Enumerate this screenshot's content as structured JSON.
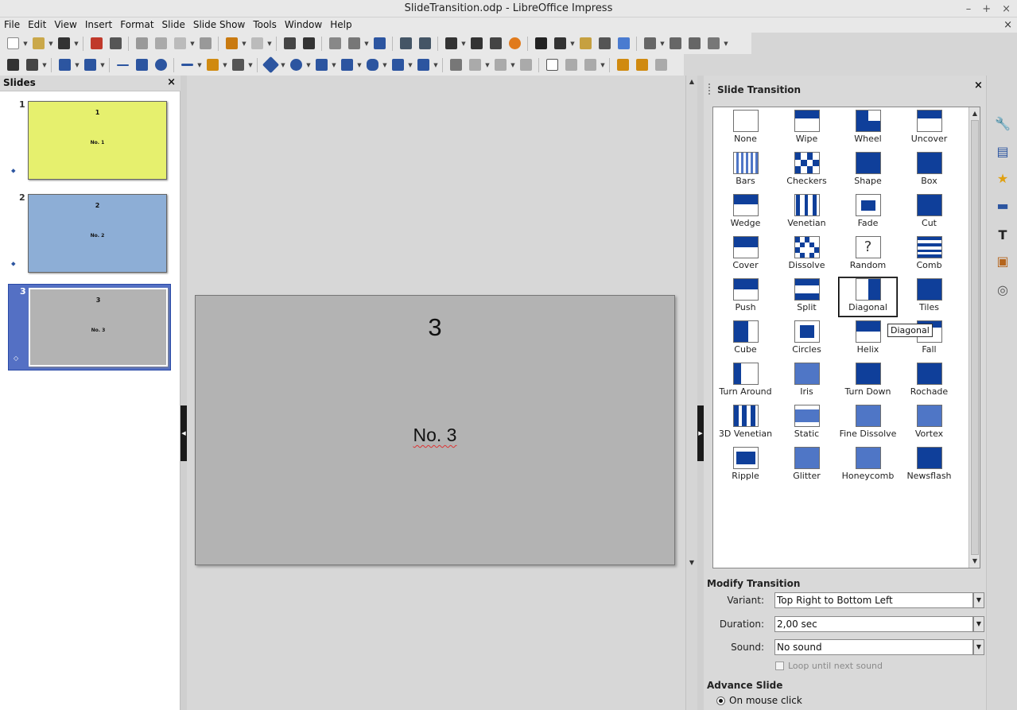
{
  "window": {
    "title": "SlideTransition.odp - LibreOffice Impress",
    "controls": [
      "–",
      "+",
      "×"
    ],
    "doc_close": "×"
  },
  "menu": [
    "File",
    "Edit",
    "View",
    "Insert",
    "Format",
    "Slide",
    "Slide Show",
    "Tools",
    "Window",
    "Help"
  ],
  "slides_panel": {
    "title": "Slides",
    "close": "×",
    "slides": [
      {
        "number": "1",
        "title": "1",
        "body": "No. 1",
        "color": "#e6f06e"
      },
      {
        "number": "2",
        "title": "2",
        "body": "No. 2",
        "color": "#8daed6"
      },
      {
        "number": "3",
        "title": "3",
        "body": "No. 3",
        "color": "#b3b3b3"
      }
    ]
  },
  "main_slide": {
    "title": "3",
    "body": "No. 3"
  },
  "transition_panel": {
    "title": "Slide Transition",
    "close": "×",
    "transitions": [
      "None",
      "Wipe",
      "Wheel",
      "Uncover",
      "Bars",
      "Checkers",
      "Shape",
      "Box",
      "Wedge",
      "Venetian",
      "Fade",
      "Cut",
      "Cover",
      "Dissolve",
      "Random",
      "Comb",
      "Push",
      "Split",
      "Diagonal",
      "Tiles",
      "Cube",
      "Circles",
      "Helix",
      "Fall",
      "Turn Around",
      "Iris",
      "Turn Down",
      "Rochade",
      "3D Venetian",
      "Static",
      "Fine Dissolve",
      "Vortex",
      "Ripple",
      "Glitter",
      "Honeycomb",
      "Newsflash"
    ],
    "selected": "Diagonal",
    "tooltip": "Diagonal",
    "random_glyph": "?",
    "modify": {
      "title": "Modify Transition",
      "variant_label": "Variant:",
      "variant_value": "Top Right to Bottom Left",
      "duration_label": "Duration:",
      "duration_value": "2,00 sec",
      "sound_label": "Sound:",
      "sound_value": "No sound",
      "loop_label": "Loop until next sound",
      "loop_checked": false
    },
    "advance": {
      "title": "Advance Slide",
      "on_click_label": "On mouse click",
      "on_click_selected": true
    }
  },
  "colors": {
    "accent": "#0f3f9a",
    "selection": "#3b5bb4"
  }
}
